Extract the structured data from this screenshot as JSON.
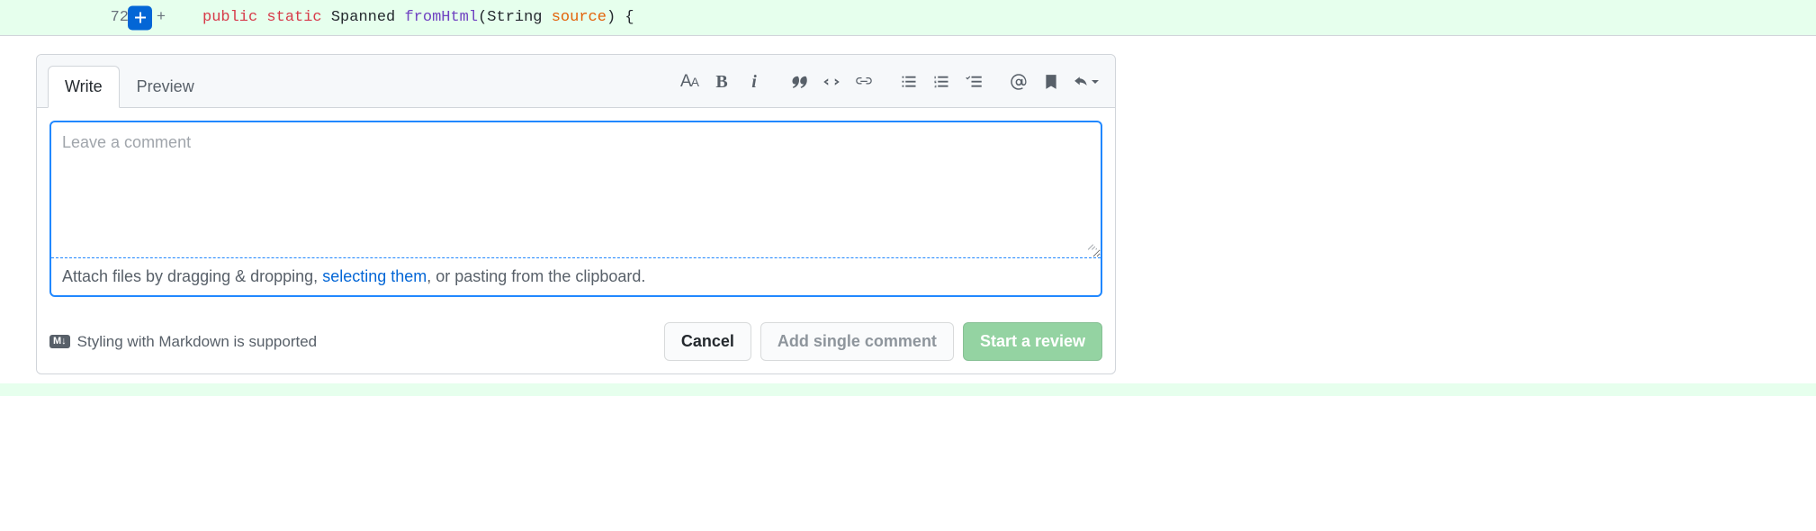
{
  "code_line": {
    "number": "72",
    "addition_marker": "+",
    "tokens": {
      "kw1": "public",
      "kw2": "static",
      "type": "Spanned",
      "fn": "fromHtml",
      "paren_open": "(",
      "param_type": "String",
      "param_name": "source",
      "paren_close": ")",
      "brace": " {"
    }
  },
  "tabs": {
    "write": "Write",
    "preview": "Preview"
  },
  "toolbar": {
    "heading": "Aᴀ"
  },
  "comment": {
    "placeholder": "Leave a comment"
  },
  "attach_hint": {
    "before": "Attach files by dragging & dropping, ",
    "link": "selecting them",
    "after": ", or pasting from the clipboard."
  },
  "markdown_hint": {
    "badge": "M↓",
    "text": "Styling with Markdown is supported"
  },
  "actions": {
    "cancel": "Cancel",
    "add_single": "Add single comment",
    "start_review": "Start a review"
  }
}
